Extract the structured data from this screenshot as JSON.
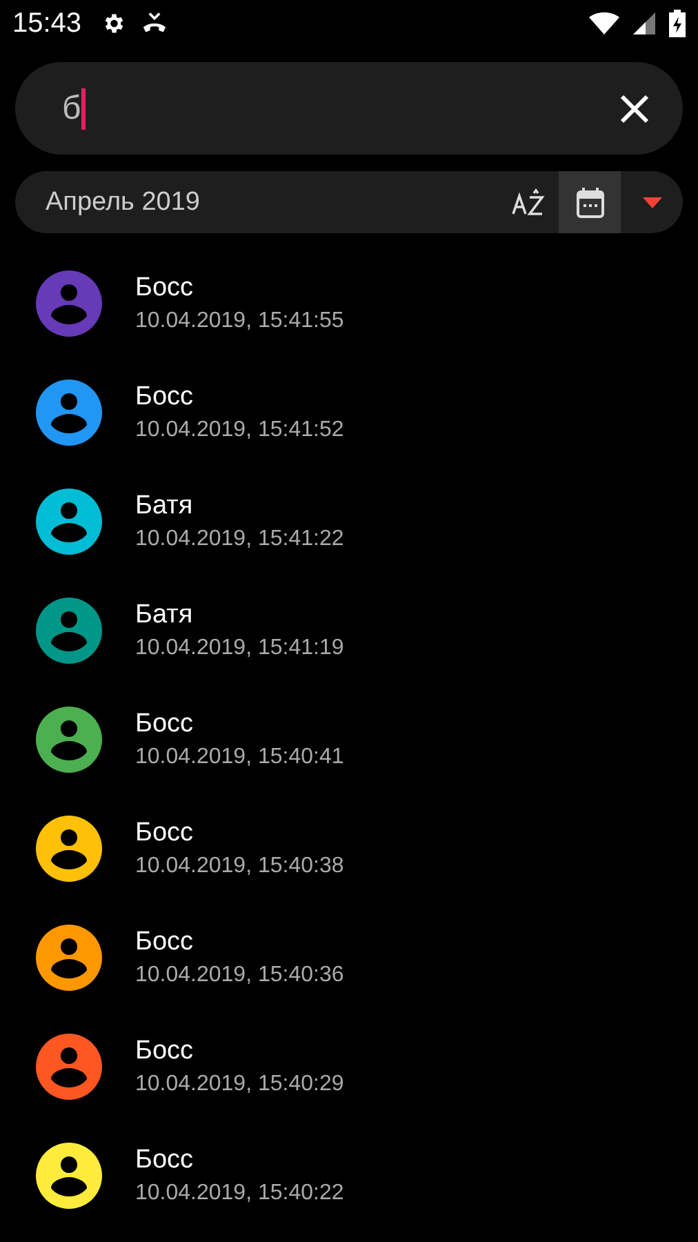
{
  "status_bar": {
    "time": "15:43"
  },
  "search": {
    "value": "б"
  },
  "filter": {
    "period": "Апрель 2019",
    "buttons": [
      {
        "kind": "sort-az",
        "selected": false
      },
      {
        "kind": "calendar",
        "selected": true
      }
    ]
  },
  "calls": [
    {
      "name": "Босс",
      "datetime": "10.04.2019, 15:41:55",
      "color": "#673ab7"
    },
    {
      "name": "Босс",
      "datetime": "10.04.2019, 15:41:52",
      "color": "#2196f3"
    },
    {
      "name": "Батя",
      "datetime": "10.04.2019, 15:41:22",
      "color": "#00bcd4"
    },
    {
      "name": "Батя",
      "datetime": "10.04.2019, 15:41:19",
      "color": "#009688"
    },
    {
      "name": "Босс",
      "datetime": "10.04.2019, 15:40:41",
      "color": "#4caf50"
    },
    {
      "name": "Босс",
      "datetime": "10.04.2019, 15:40:38",
      "color": "#ffc107"
    },
    {
      "name": "Босс",
      "datetime": "10.04.2019, 15:40:36",
      "color": "#ff9800"
    },
    {
      "name": "Босс",
      "datetime": "10.04.2019, 15:40:29",
      "color": "#ff5722"
    },
    {
      "name": "Босс",
      "datetime": "10.04.2019, 15:40:22",
      "color": "#ffeb3b"
    }
  ]
}
